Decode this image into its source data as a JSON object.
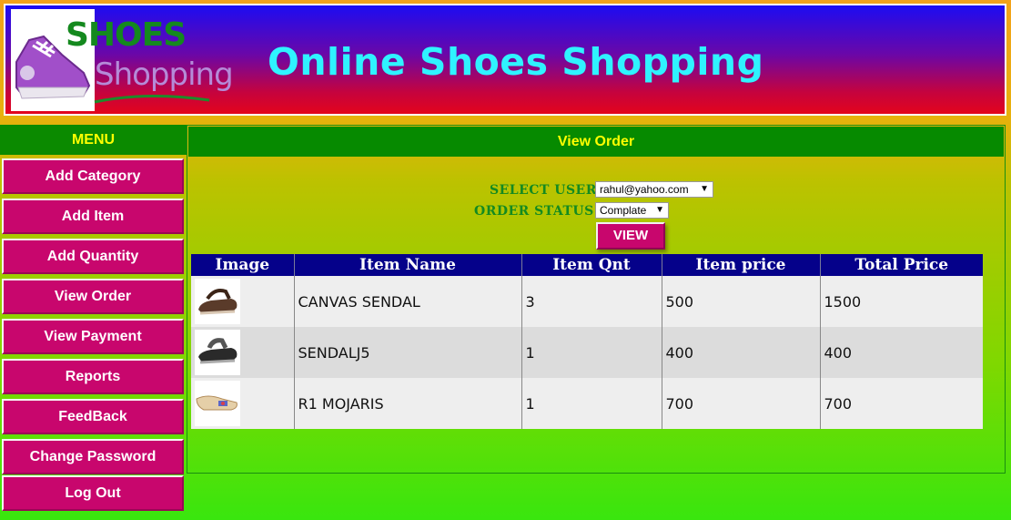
{
  "header": {
    "logo_line1": "SHOES",
    "logo_line2": "Shopping",
    "title": "Online Shoes Shopping"
  },
  "sidebar": {
    "heading": "MENU",
    "items": [
      {
        "label": "Add Category"
      },
      {
        "label": "Add Item"
      },
      {
        "label": "Add Quantity"
      },
      {
        "label": "View Order"
      },
      {
        "label": "View Payment"
      },
      {
        "label": "Reports"
      },
      {
        "label": "FeedBack"
      },
      {
        "label": "Change Password"
      },
      {
        "label": "Log Out"
      }
    ]
  },
  "main": {
    "heading": "View Order",
    "form": {
      "user_label": "SELECT USER:",
      "user_value": "rahul@yahoo.com",
      "status_label": "ORDER STATUS:",
      "status_value": "Complate",
      "view_button": "VIEW"
    },
    "table": {
      "columns": [
        "Image",
        "Item Name",
        "Item Qnt",
        "Item price",
        "Total Price"
      ],
      "rows": [
        {
          "image": "sandal-brown-icon",
          "name": "CANVAS SENDAL",
          "qnt": "3",
          "price": "500",
          "total": "1500"
        },
        {
          "image": "sandal-black-icon",
          "name": "SENDALJ5",
          "qnt": "1",
          "price": "400",
          "total": "400"
        },
        {
          "image": "mojari-icon",
          "name": "R1 MOJARIS",
          "qnt": "1",
          "price": "700",
          "total": "700"
        }
      ]
    }
  },
  "colors": {
    "accent": "#c8066d",
    "header_bar": "#068a00",
    "header_text": "#ffff00",
    "table_head": "#05018a",
    "title_text": "#2ff3ff"
  }
}
